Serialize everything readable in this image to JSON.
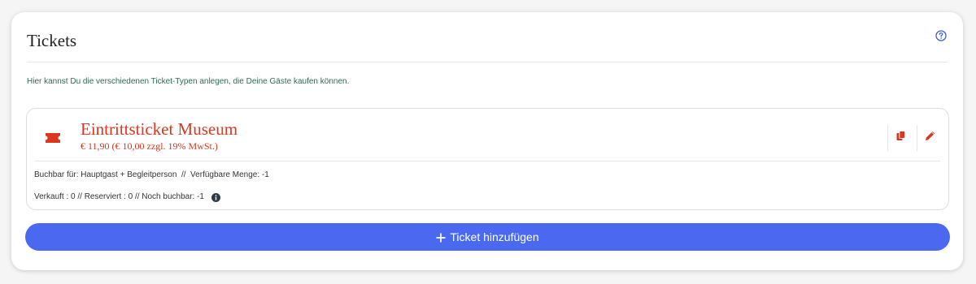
{
  "panel": {
    "title": "Tickets",
    "description": "Hier kannst Du die verschiedenen Ticket-Typen anlegen, die Deine Gäste kaufen können.",
    "help_icon": "question-circle-icon"
  },
  "tickets": [
    {
      "name": "Eintrittsticket Museum",
      "price": "€ 11,90 (€ 10,00 zzgl. 19% MwSt.)",
      "info_line": "Buchbar für: Hauptgast + Begleitperson  //  Verfügbare Menge: -1",
      "stats_line": "Verkauft : 0 // Reserviert : 0 // Noch buchbar: -1",
      "icon": "ticket-icon",
      "actions": {
        "copy_icon": "copy-icon",
        "edit_icon": "pencil-icon"
      }
    }
  ],
  "add_button": {
    "label": "Ticket hinzufügen",
    "icon": "plus-icon"
  },
  "colors": {
    "accent_red": "#d9371f",
    "button_blue": "#4a69f0",
    "description_green": "#2e6b52",
    "help_blue": "#3b5bdb"
  }
}
